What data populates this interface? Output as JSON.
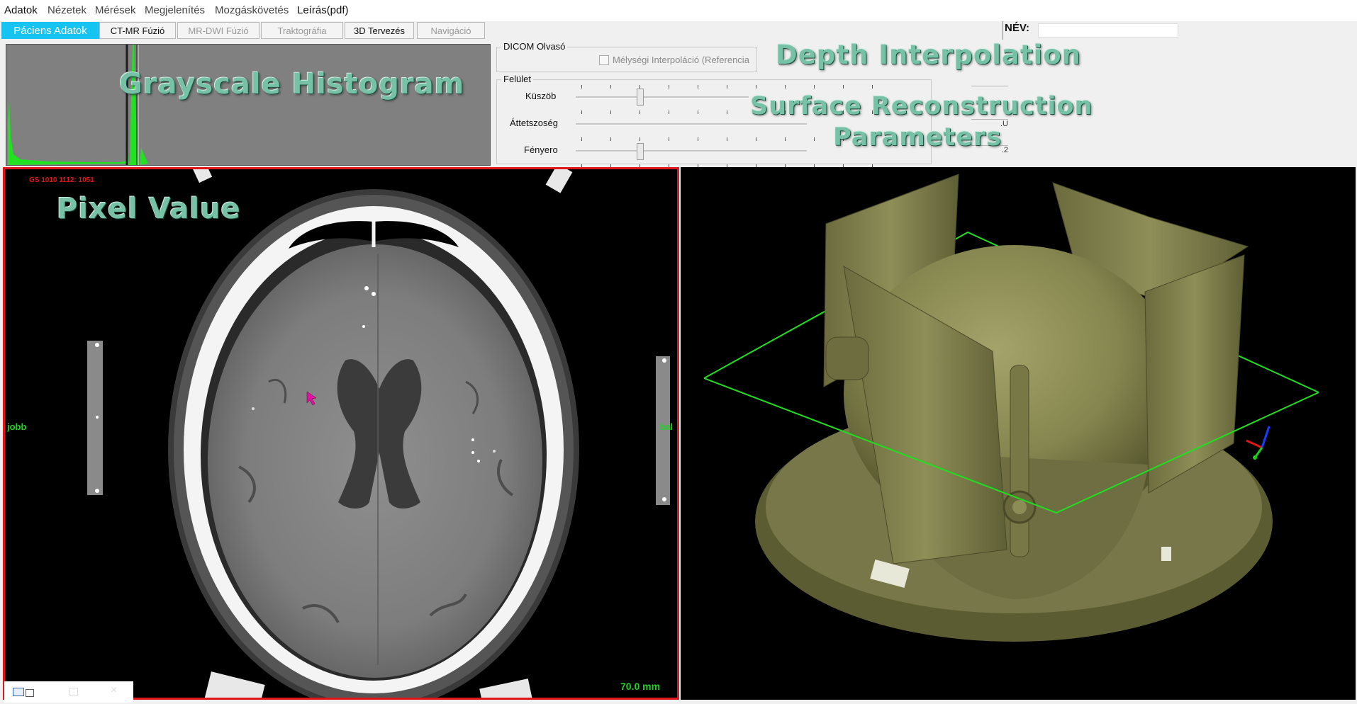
{
  "menu": [
    "Adatok",
    "Nézetek",
    "Mérések",
    "Megjelenítés",
    "Mozgáskövetés",
    "Leírás(pdf)"
  ],
  "tabs": [
    {
      "label": "Páciens Adatok",
      "state": "active"
    },
    {
      "label": "CT-MR Fúzió",
      "state": "normal"
    },
    {
      "label": "MR-DWI Fúzió",
      "state": "disabled"
    },
    {
      "label": "Traktográfia",
      "state": "disabled"
    },
    {
      "label": "3D Tervezés",
      "state": "normal"
    },
    {
      "label": "Navigáció",
      "state": "disabled"
    }
  ],
  "name_label": "NÉV:",
  "name_value": "",
  "dicom": {
    "title": "DICOM Olvasó",
    "checkbox_label": "Mélységi Interpoláció (Referencia",
    "checked": false
  },
  "surface": {
    "title": "Felület",
    "sliders": [
      {
        "label": "Küszöb",
        "value_text": ""
      },
      {
        "label": "Áttetszoség",
        "value_text": ".U"
      },
      {
        "label": "Fényero",
        "value_text": ".2"
      }
    ]
  },
  "overlays": {
    "histogram": "Grayscale Histogram",
    "depth": "Depth Interpolation",
    "surface_line1": "Surface Reconstruction",
    "surface_line2": "Parameters",
    "pixel": "Pixel Value"
  },
  "ct": {
    "pixel_readout": "GS 1010 1112:  1051",
    "left_label": "jobb",
    "right_label": "bal",
    "scale": "70.0 mm"
  },
  "colors": {
    "accent_tab": "#15c4f0",
    "ct_border": "#e0141b",
    "histogram_bar": "#22e022",
    "model": "#8a8a55",
    "bbox": "#1fe01f"
  }
}
